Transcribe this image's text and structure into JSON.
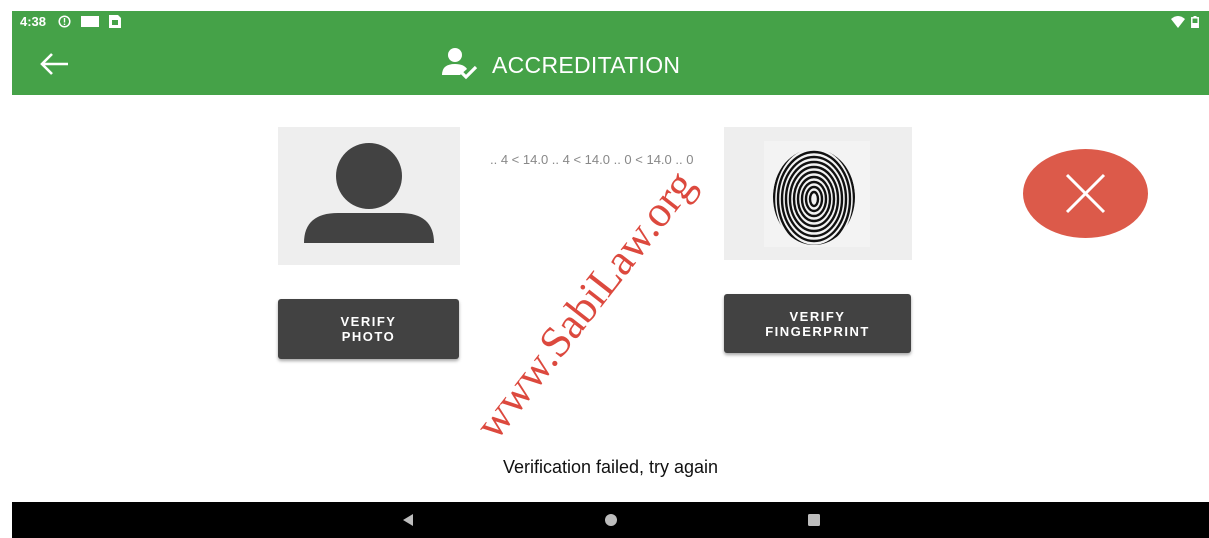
{
  "status_bar": {
    "time": "4:38",
    "icons": [
      "info-circle-icon",
      "rectangle-icon",
      "sim-icon"
    ],
    "right_icons": [
      "wifi-icon",
      "battery-icon"
    ]
  },
  "app_bar": {
    "title": "ACCREDITATION",
    "back_icon": "arrow-left-icon",
    "title_icon": "user-check-icon",
    "color": "#45a248"
  },
  "photo": {
    "placeholder_icon": "person-icon",
    "button_label_line1": "VERIFY",
    "button_label_line2": "PHOTO"
  },
  "progress": {
    "text": ".. 4 < 14.0 .. 4 < 14.0 .. 0 < 14.0 .. 0"
  },
  "fingerprint": {
    "image_icon": "fingerprint-image",
    "button_label_line1": "VERIFY",
    "button_label_line2": "FINGERPRINT"
  },
  "status_indicator": {
    "icon": "close-icon",
    "color": "#dc5a4a"
  },
  "message": {
    "text": "Verification failed, try again"
  },
  "watermark": {
    "text": "www.SabiLaw.org"
  },
  "nav_bar": {
    "buttons": [
      "back-triangle-icon",
      "home-circle-icon",
      "recents-square-icon"
    ]
  }
}
